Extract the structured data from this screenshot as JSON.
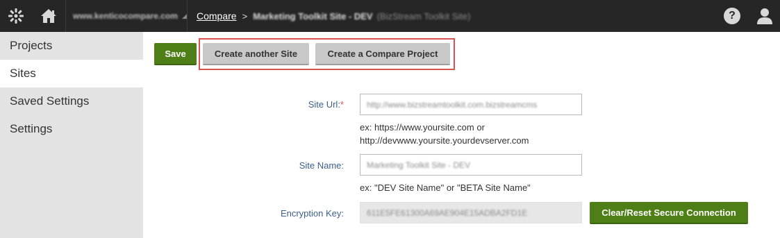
{
  "header": {
    "site_selector": "www.kenticocompare.com",
    "breadcrumb": {
      "root": "Compare",
      "separator": ">",
      "current": "Marketing Toolkit Site - DEV",
      "current_sub": "(BizStream Toolkit Site)"
    },
    "help_label": "?"
  },
  "sidebar": {
    "items": [
      {
        "label": "Projects"
      },
      {
        "label": "Sites"
      },
      {
        "label": "Saved Settings"
      },
      {
        "label": "Settings"
      }
    ]
  },
  "toolbar": {
    "save_label": "Save",
    "create_site_label": "Create another Site",
    "create_project_label": "Create a Compare Project"
  },
  "form": {
    "site_url": {
      "label": "Site Url:",
      "required_mark": "*",
      "value": "http://www.bizstreamtoolkit.com.bizstreamcms",
      "hint_line1": "ex: https://www.yoursite.com or",
      "hint_line2": "http://devwww.yoursite.yourdevserver.com"
    },
    "site_name": {
      "label": "Site Name:",
      "value": "Marketing Toolkit Site - DEV",
      "hint": "ex: \"DEV Site Name\" or \"BETA Site Name\""
    },
    "encryption_key": {
      "label": "Encryption Key:",
      "value": "611E5FE61300A69AE904E15ADBA2FD1E",
      "reset_label": "Clear/Reset Secure Connection"
    }
  },
  "colors": {
    "header_bg": "#262626",
    "accent_green": "#4d7f16",
    "label_blue": "#3b5f8d",
    "highlight_red": "#d9534f"
  }
}
